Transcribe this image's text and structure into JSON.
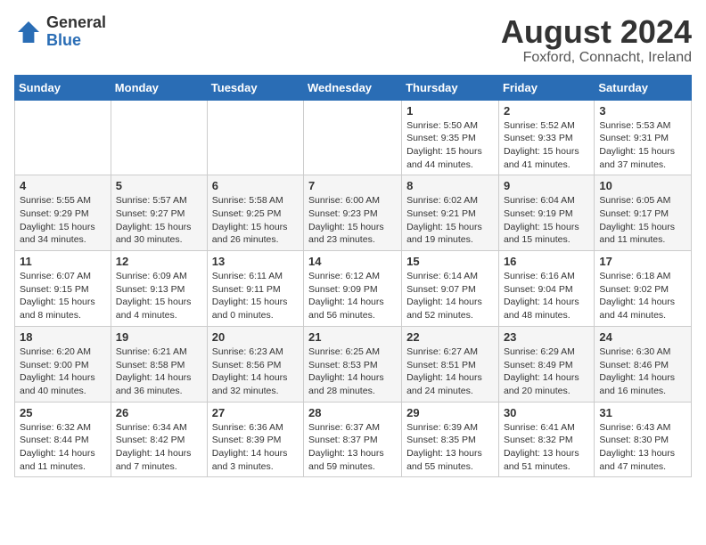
{
  "header": {
    "logo_general": "General",
    "logo_blue": "Blue",
    "month_year": "August 2024",
    "location": "Foxford, Connacht, Ireland"
  },
  "weekdays": [
    "Sunday",
    "Monday",
    "Tuesday",
    "Wednesday",
    "Thursday",
    "Friday",
    "Saturday"
  ],
  "weeks": [
    [
      {
        "day": "",
        "sunrise": "",
        "sunset": "",
        "daylight": ""
      },
      {
        "day": "",
        "sunrise": "",
        "sunset": "",
        "daylight": ""
      },
      {
        "day": "",
        "sunrise": "",
        "sunset": "",
        "daylight": ""
      },
      {
        "day": "",
        "sunrise": "",
        "sunset": "",
        "daylight": ""
      },
      {
        "day": "1",
        "sunrise": "Sunrise: 5:50 AM",
        "sunset": "Sunset: 9:35 PM",
        "daylight": "Daylight: 15 hours and 44 minutes."
      },
      {
        "day": "2",
        "sunrise": "Sunrise: 5:52 AM",
        "sunset": "Sunset: 9:33 PM",
        "daylight": "Daylight: 15 hours and 41 minutes."
      },
      {
        "day": "3",
        "sunrise": "Sunrise: 5:53 AM",
        "sunset": "Sunset: 9:31 PM",
        "daylight": "Daylight: 15 hours and 37 minutes."
      }
    ],
    [
      {
        "day": "4",
        "sunrise": "Sunrise: 5:55 AM",
        "sunset": "Sunset: 9:29 PM",
        "daylight": "Daylight: 15 hours and 34 minutes."
      },
      {
        "day": "5",
        "sunrise": "Sunrise: 5:57 AM",
        "sunset": "Sunset: 9:27 PM",
        "daylight": "Daylight: 15 hours and 30 minutes."
      },
      {
        "day": "6",
        "sunrise": "Sunrise: 5:58 AM",
        "sunset": "Sunset: 9:25 PM",
        "daylight": "Daylight: 15 hours and 26 minutes."
      },
      {
        "day": "7",
        "sunrise": "Sunrise: 6:00 AM",
        "sunset": "Sunset: 9:23 PM",
        "daylight": "Daylight: 15 hours and 23 minutes."
      },
      {
        "day": "8",
        "sunrise": "Sunrise: 6:02 AM",
        "sunset": "Sunset: 9:21 PM",
        "daylight": "Daylight: 15 hours and 19 minutes."
      },
      {
        "day": "9",
        "sunrise": "Sunrise: 6:04 AM",
        "sunset": "Sunset: 9:19 PM",
        "daylight": "Daylight: 15 hours and 15 minutes."
      },
      {
        "day": "10",
        "sunrise": "Sunrise: 6:05 AM",
        "sunset": "Sunset: 9:17 PM",
        "daylight": "Daylight: 15 hours and 11 minutes."
      }
    ],
    [
      {
        "day": "11",
        "sunrise": "Sunrise: 6:07 AM",
        "sunset": "Sunset: 9:15 PM",
        "daylight": "Daylight: 15 hours and 8 minutes."
      },
      {
        "day": "12",
        "sunrise": "Sunrise: 6:09 AM",
        "sunset": "Sunset: 9:13 PM",
        "daylight": "Daylight: 15 hours and 4 minutes."
      },
      {
        "day": "13",
        "sunrise": "Sunrise: 6:11 AM",
        "sunset": "Sunset: 9:11 PM",
        "daylight": "Daylight: 15 hours and 0 minutes."
      },
      {
        "day": "14",
        "sunrise": "Sunrise: 6:12 AM",
        "sunset": "Sunset: 9:09 PM",
        "daylight": "Daylight: 14 hours and 56 minutes."
      },
      {
        "day": "15",
        "sunrise": "Sunrise: 6:14 AM",
        "sunset": "Sunset: 9:07 PM",
        "daylight": "Daylight: 14 hours and 52 minutes."
      },
      {
        "day": "16",
        "sunrise": "Sunrise: 6:16 AM",
        "sunset": "Sunset: 9:04 PM",
        "daylight": "Daylight: 14 hours and 48 minutes."
      },
      {
        "day": "17",
        "sunrise": "Sunrise: 6:18 AM",
        "sunset": "Sunset: 9:02 PM",
        "daylight": "Daylight: 14 hours and 44 minutes."
      }
    ],
    [
      {
        "day": "18",
        "sunrise": "Sunrise: 6:20 AM",
        "sunset": "Sunset: 9:00 PM",
        "daylight": "Daylight: 14 hours and 40 minutes."
      },
      {
        "day": "19",
        "sunrise": "Sunrise: 6:21 AM",
        "sunset": "Sunset: 8:58 PM",
        "daylight": "Daylight: 14 hours and 36 minutes."
      },
      {
        "day": "20",
        "sunrise": "Sunrise: 6:23 AM",
        "sunset": "Sunset: 8:56 PM",
        "daylight": "Daylight: 14 hours and 32 minutes."
      },
      {
        "day": "21",
        "sunrise": "Sunrise: 6:25 AM",
        "sunset": "Sunset: 8:53 PM",
        "daylight": "Daylight: 14 hours and 28 minutes."
      },
      {
        "day": "22",
        "sunrise": "Sunrise: 6:27 AM",
        "sunset": "Sunset: 8:51 PM",
        "daylight": "Daylight: 14 hours and 24 minutes."
      },
      {
        "day": "23",
        "sunrise": "Sunrise: 6:29 AM",
        "sunset": "Sunset: 8:49 PM",
        "daylight": "Daylight: 14 hours and 20 minutes."
      },
      {
        "day": "24",
        "sunrise": "Sunrise: 6:30 AM",
        "sunset": "Sunset: 8:46 PM",
        "daylight": "Daylight: 14 hours and 16 minutes."
      }
    ],
    [
      {
        "day": "25",
        "sunrise": "Sunrise: 6:32 AM",
        "sunset": "Sunset: 8:44 PM",
        "daylight": "Daylight: 14 hours and 11 minutes."
      },
      {
        "day": "26",
        "sunrise": "Sunrise: 6:34 AM",
        "sunset": "Sunset: 8:42 PM",
        "daylight": "Daylight: 14 hours and 7 minutes."
      },
      {
        "day": "27",
        "sunrise": "Sunrise: 6:36 AM",
        "sunset": "Sunset: 8:39 PM",
        "daylight": "Daylight: 14 hours and 3 minutes."
      },
      {
        "day": "28",
        "sunrise": "Sunrise: 6:37 AM",
        "sunset": "Sunset: 8:37 PM",
        "daylight": "Daylight: 13 hours and 59 minutes."
      },
      {
        "day": "29",
        "sunrise": "Sunrise: 6:39 AM",
        "sunset": "Sunset: 8:35 PM",
        "daylight": "Daylight: 13 hours and 55 minutes."
      },
      {
        "day": "30",
        "sunrise": "Sunrise: 6:41 AM",
        "sunset": "Sunset: 8:32 PM",
        "daylight": "Daylight: 13 hours and 51 minutes."
      },
      {
        "day": "31",
        "sunrise": "Sunrise: 6:43 AM",
        "sunset": "Sunset: 8:30 PM",
        "daylight": "Daylight: 13 hours and 47 minutes."
      }
    ]
  ]
}
